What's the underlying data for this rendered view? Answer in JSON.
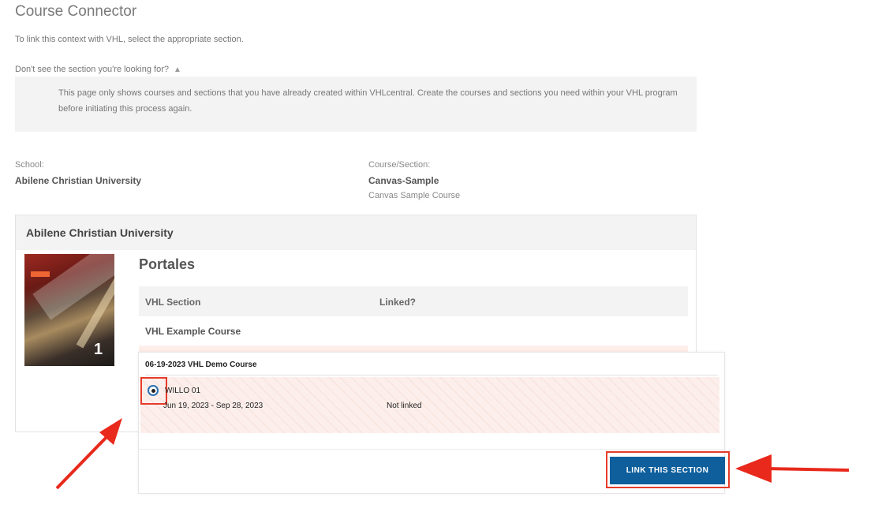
{
  "header": {
    "title": "Course Connector",
    "instruction": "To link this context with VHL, select the appropriate section.",
    "dont_see_label": "Don't see the section you're looking for?",
    "info_text": "This page only shows courses and sections that you have already created within VHLcentral. Create the courses and sections you need within your VHL program before initiating this process again."
  },
  "school": {
    "label": "School:",
    "value": "Abilene Christian University"
  },
  "course_section": {
    "label": "Course/Section:",
    "value": "Canvas-Sample",
    "subvalue": "Canvas Sample Course"
  },
  "card": {
    "header": "Abilene Christian University",
    "program": "Portales",
    "table_headers": [
      "VHL Section",
      "Linked?"
    ],
    "course_name": "VHL Example Course"
  },
  "popup": {
    "course_title": "06-19-2023 VHL Demo Course",
    "section_name": "WILLO 01",
    "section_dates": "Jun 19, 2023 - Sep 28, 2023",
    "section_status": "Not linked",
    "radio_selected": true
  },
  "actions": {
    "link_button": "LINK THIS SECTION"
  },
  "colors": {
    "accent": "#0e5f9c",
    "highlight": "#e53b28",
    "row_bg": "#fcefeb"
  },
  "icons": {
    "expand": "chevron-up-icon",
    "annotation": "red-arrow-icon"
  }
}
